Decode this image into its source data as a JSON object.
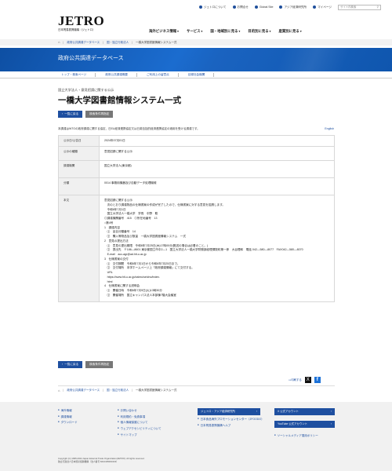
{
  "util_links": [
    "ジェトロについて",
    "お問合せ",
    "Global Site",
    "アジア経済研究所",
    "マイページ"
  ],
  "search_placeholder": "サイト内検索",
  "logo": {
    "word": "JETRO",
    "sub": "日本貿易振興機構（ジェトロ）"
  },
  "main_nav": [
    "海外ビジネス情報",
    "サービス",
    "国・地域別に見る",
    "目的別に見る",
    "産業別に見る"
  ],
  "breadcrumb": [
    "政府公共調達データベース",
    "国・独立行政法人",
    "一橋大学図書館情報システム一式"
  ],
  "band_title": "政府公共調達データベース",
  "sub_nav": [
    "トップ・検索ページ",
    "政府公共調達概要",
    "ご利用上の留意点",
    "目録社会機関"
  ],
  "kicker": "国立大学法人・意見招請に関する公示",
  "title": "一橋大学図書館情報システム一式",
  "buttons": {
    "back": "一覧に戻る",
    "print": "検索条件再指定"
  },
  "intro": "本調達はWTOの政府調達に関する協定、日EU経済連携協定又は日英包括的経済連携協定の適用を受ける調達です。",
  "english_link": "English",
  "rows": [
    {
      "label": "公示日/公告日",
      "value": "2024年07月01日"
    },
    {
      "label": "公示の種類",
      "value": "意見招請に関する公示"
    },
    {
      "label": "調達機関",
      "value": "国立大学法人(東京都)"
    },
    {
      "label": "分類",
      "value": "0014 事務用機器及び自動データ処理機械"
    },
    {
      "label": "本文",
      "value": "意見招請に関する公示\n　次のとおり調達物品の仕様書案の作成が完了したので、仕様書案に対する意見を招請します。\n　令和6年7月1日\n　国立大学法人一橋大学　学長　中野　聡\n◎調達機関番号　415　◎所在地番号　13\n○第4号\n1　調達内容\n　⑴　品目分類番号　14\n　⑵　購入等物品及び数量　一橋大学図書館情報システム　一式\n2　意見の提出方法\n　⑴　意見の提出期限　令和6年7月25日(木)17時00分(郵送の場合は必着のこと。)\n　⑵　提出先　〒186―8601 東京都国立市中2―1　国立大学法人一橋大学財務部経理課契約第一係　大谷理和　電話 042―580―8077　FAX042―580―8070\n　E-mail　acc-agr@ad.hit-u.ac.jp\n3　仕様書案の交付\n　⑴　交付期間　令和6年7月1日から令和6年7月25日まで。\n　⑵　交付場所　本学ホームページ上「政府調達情報」にて交付する。\n　URL\n　https://www.hit-u.ac.jp/zaimu/seicho/index.\n　html\n4　仕様書案に関する説明会\n　⑴　開催日時　令和6年7月9日(火)13時30分\n　⑵　開催場所　国立キャンパス法人本部棟7階大会議室"
    }
  ],
  "share": {
    "print": "印刷する",
    "x": "X",
    "fb": "f"
  },
  "footer": {
    "col1": [
      "海外情報",
      "調達情報",
      "ダウンロード"
    ],
    "col2": [
      "お問い合わせ",
      "利用規約・免責事項",
      "個人情報保護について",
      "ウェブアクセシビリティについて",
      "サイトマップ"
    ],
    "col3_btn": "ジェトロ・アジア経済研究所",
    "col3": [
      "日本食品海外プロモーションセンター（JFOODO）",
      "日本貿易振興機構ヘルプ"
    ],
    "col4_btn1": "X 公式アカウント",
    "col4_btn2": "YouTube 公式アカウント",
    "col4": [
      "ソーシャルメディア運用ポリシー"
    ],
    "copyright": "Copyright (C) 1995-2024 Japan External Trade Organization(JETRO). All rights reserved.",
    "copyright2": "独立行政法人日本貿易振興機構（法人番号 6010405003434）"
  },
  "colors": {
    "brand": "#1e4fa0",
    "band": "#1565c0"
  }
}
